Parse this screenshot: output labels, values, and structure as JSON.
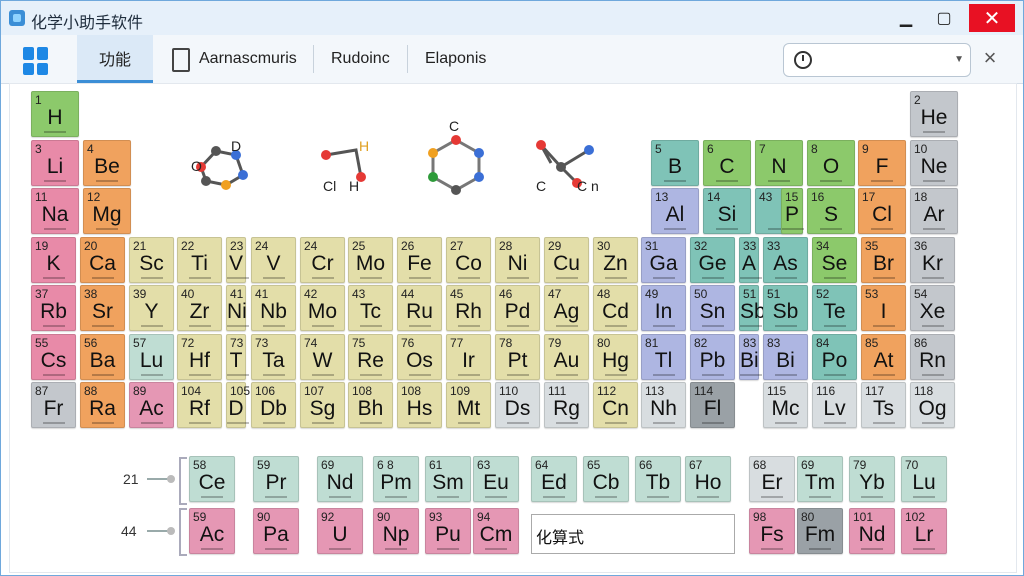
{
  "window": {
    "title": "化学小助手软件",
    "minimize_label": "▁",
    "maximize_label": "▢",
    "close_label": "✕"
  },
  "toolbar": {
    "tabs": [
      "功能",
      "Aarnascmuris",
      "Rudoinc",
      "Elaponis"
    ],
    "search": {
      "value": "",
      "placeholder": ""
    },
    "close_label": "×"
  },
  "colors": {
    "nonmetal": "#8cc96b",
    "alkali": "#e88aa8",
    "alkaline": "#f0a25e",
    "transition": "#e3dea9",
    "post": "#aeb6e2",
    "metalloid": "#7fc3b7",
    "halogen": "#f0a25e",
    "noble": "#c3c7cc",
    "lanth": "#bfddd3",
    "act": "#e597b4",
    "unknown": "#d8dde0",
    "dark": "#9aa1a6"
  },
  "elements": [
    {
      "n": "1",
      "s": "H",
      "c": "nonmetal",
      "r": 0,
      "col": 0
    },
    {
      "n": "2",
      "s": "He",
      "c": "noble",
      "r": 0,
      "col": 17
    },
    {
      "n": "3",
      "s": "Li",
      "c": "alkali",
      "r": 1,
      "col": 0
    },
    {
      "n": "4",
      "s": "Be",
      "c": "alkaline",
      "r": 1,
      "col": 1
    },
    {
      "n": "5",
      "s": "B",
      "c": "metalloid",
      "r": 1,
      "col": 12
    },
    {
      "n": "6",
      "s": "C",
      "c": "nonmetal",
      "r": 1,
      "col": 13
    },
    {
      "n": "7",
      "s": "N",
      "c": "nonmetal",
      "r": 1,
      "col": 14
    },
    {
      "n": "8",
      "s": "O",
      "c": "nonmetal",
      "r": 1,
      "col": 15
    },
    {
      "n": "9",
      "s": "F",
      "c": "halogen",
      "r": 1,
      "col": 16
    },
    {
      "n": "10",
      "s": "Ne",
      "c": "noble",
      "r": 1,
      "col": 17
    },
    {
      "n": "11",
      "s": "Na",
      "c": "alkali",
      "r": 2,
      "col": 0
    },
    {
      "n": "12",
      "s": "Mg",
      "c": "alkaline",
      "r": 2,
      "col": 1
    },
    {
      "n": "13",
      "s": "Al",
      "c": "post",
      "r": 2,
      "col": 12
    },
    {
      "n": "14",
      "s": "Si",
      "c": "metalloid",
      "r": 2,
      "col": 13
    },
    {
      "n": "43",
      "s": "",
      "c": "metalloid",
      "r": 2,
      "col": 14,
      "half": true
    },
    {
      "n": "15",
      "s": "P",
      "c": "nonmetal",
      "r": 2,
      "col": 14.5,
      "w": 0.5
    },
    {
      "n": "16",
      "s": "S",
      "c": "nonmetal",
      "r": 2,
      "col": 15
    },
    {
      "n": "17",
      "s": "Cl",
      "c": "halogen",
      "r": 2,
      "col": 16
    },
    {
      "n": "18",
      "s": "Ar",
      "c": "noble",
      "r": 2,
      "col": 17
    },
    {
      "n": "19",
      "s": "K",
      "c": "alkali",
      "r": 3,
      "col": 0
    },
    {
      "n": "20",
      "s": "Ca",
      "c": "alkaline",
      "r": 3,
      "col": 1
    },
    {
      "n": "21",
      "s": "Sc",
      "c": "transition",
      "r": 3,
      "col": 2
    },
    {
      "n": "22",
      "s": "Ti",
      "c": "transition",
      "r": 3,
      "col": 3
    },
    {
      "n": "23",
      "s": "V",
      "c": "transition",
      "r": 3,
      "col": 4,
      "w": 0.5
    },
    {
      "n": "24",
      "s": "V",
      "c": "transition",
      "r": 3,
      "col": 4.5
    },
    {
      "n": "24",
      "s": "Cr",
      "c": "transition",
      "r": 3,
      "col": 5.5
    },
    {
      "n": "25",
      "s": "Mo",
      "c": "transition",
      "r": 3,
      "col": 6.5
    },
    {
      "n": "26",
      "s": "Fe",
      "c": "transition",
      "r": 3,
      "col": 7.5
    },
    {
      "n": "27",
      "s": "Co",
      "c": "transition",
      "r": 3,
      "col": 8.5
    },
    {
      "n": "28",
      "s": "Ni",
      "c": "transition",
      "r": 3,
      "col": 9.5
    },
    {
      "n": "29",
      "s": "Cu",
      "c": "transition",
      "r": 3,
      "col": 10.5
    },
    {
      "n": "30",
      "s": "Zn",
      "c": "transition",
      "r": 3,
      "col": 11.5
    },
    {
      "n": "31",
      "s": "Ga",
      "c": "post",
      "r": 3,
      "col": 12.5
    },
    {
      "n": "32",
      "s": "Ge",
      "c": "metalloid",
      "r": 3,
      "col": 13.5
    },
    {
      "n": "33",
      "s": "A",
      "c": "metalloid",
      "r": 3,
      "col": 14.5,
      "w": 0.5
    },
    {
      "n": "33",
      "s": "As",
      "c": "metalloid",
      "r": 3,
      "col": 15
    },
    {
      "n": "34",
      "s": "Se",
      "c": "nonmetal",
      "r": 3,
      "col": 16
    },
    {
      "n": "35",
      "s": "Br",
      "c": "halogen",
      "r": 3,
      "col": 17
    },
    {
      "n": "36",
      "s": "Kr",
      "c": "noble",
      "r": 3,
      "col": 18
    },
    {
      "n": "37",
      "s": "Rb",
      "c": "alkali",
      "r": 4,
      "col": 0
    },
    {
      "n": "38",
      "s": "Sr",
      "c": "alkaline",
      "r": 4,
      "col": 1
    },
    {
      "n": "39",
      "s": "Y",
      "c": "transition",
      "r": 4,
      "col": 2
    },
    {
      "n": "40",
      "s": "Zr",
      "c": "transition",
      "r": 4,
      "col": 3
    },
    {
      "n": "41",
      "s": "Ni",
      "c": "transition",
      "r": 4,
      "col": 4,
      "w": 0.5
    },
    {
      "n": "41",
      "s": "Nb",
      "c": "transition",
      "r": 4,
      "col": 4.5
    },
    {
      "n": "42",
      "s": "Mo",
      "c": "transition",
      "r": 4,
      "col": 5.5
    },
    {
      "n": "43",
      "s": "Tc",
      "c": "transition",
      "r": 4,
      "col": 6.5
    },
    {
      "n": "44",
      "s": "Ru",
      "c": "transition",
      "r": 4,
      "col": 7.5
    },
    {
      "n": "45",
      "s": "Rh",
      "c": "transition",
      "r": 4,
      "col": 8.5
    },
    {
      "n": "46",
      "s": "Pd",
      "c": "transition",
      "r": 4,
      "col": 9.5
    },
    {
      "n": "47",
      "s": "Ag",
      "c": "transition",
      "r": 4,
      "col": 10.5
    },
    {
      "n": "48",
      "s": "Cd",
      "c": "transition",
      "r": 4,
      "col": 11.5
    },
    {
      "n": "49",
      "s": "In",
      "c": "post",
      "r": 4,
      "col": 12.5
    },
    {
      "n": "50",
      "s": "Sn",
      "c": "post",
      "r": 4,
      "col": 13.5
    },
    {
      "n": "51",
      "s": "Sb",
      "c": "metalloid",
      "r": 4,
      "col": 14.5,
      "w": 0.5
    },
    {
      "n": "51",
      "s": "Sb",
      "c": "metalloid",
      "r": 4,
      "col": 15
    },
    {
      "n": "52",
      "s": "Te",
      "c": "metalloid",
      "r": 4,
      "col": 16
    },
    {
      "n": "53",
      "s": "I",
      "c": "halogen",
      "r": 4,
      "col": 17
    },
    {
      "n": "54",
      "s": "Xe",
      "c": "noble",
      "r": 4,
      "col": 18
    },
    {
      "n": "55",
      "s": "Cs",
      "c": "alkali",
      "r": 5,
      "col": 0
    },
    {
      "n": "56",
      "s": "Ba",
      "c": "alkaline",
      "r": 5,
      "col": 1
    },
    {
      "n": "57",
      "s": "Lu",
      "c": "lanth",
      "r": 5,
      "col": 2
    },
    {
      "n": "72",
      "s": "Hf",
      "c": "transition",
      "r": 5,
      "col": 3
    },
    {
      "n": "73",
      "s": "T",
      "c": "transition",
      "r": 5,
      "col": 4,
      "w": 0.5
    },
    {
      "n": "73",
      "s": "Ta",
      "c": "transition",
      "r": 5,
      "col": 4.5
    },
    {
      "n": "74",
      "s": "W",
      "c": "transition",
      "r": 5,
      "col": 5.5
    },
    {
      "n": "75",
      "s": "Re",
      "c": "transition",
      "r": 5,
      "col": 6.5
    },
    {
      "n": "76",
      "s": "Os",
      "c": "transition",
      "r": 5,
      "col": 7.5
    },
    {
      "n": "77",
      "s": "Ir",
      "c": "transition",
      "r": 5,
      "col": 8.5
    },
    {
      "n": "78",
      "s": "Pt",
      "c": "transition",
      "r": 5,
      "col": 9.5
    },
    {
      "n": "79",
      "s": "Au",
      "c": "transition",
      "r": 5,
      "col": 10.5
    },
    {
      "n": "80",
      "s": "Hg",
      "c": "transition",
      "r": 5,
      "col": 11.5
    },
    {
      "n": "81",
      "s": "Tl",
      "c": "post",
      "r": 5,
      "col": 12.5
    },
    {
      "n": "82",
      "s": "Pb",
      "c": "post",
      "r": 5,
      "col": 13.5
    },
    {
      "n": "83",
      "s": "Bi",
      "c": "post",
      "r": 5,
      "col": 14.5,
      "w": 0.5
    },
    {
      "n": "83",
      "s": "Bi",
      "c": "post",
      "r": 5,
      "col": 15
    },
    {
      "n": "84",
      "s": "Po",
      "c": "metalloid",
      "r": 5,
      "col": 16
    },
    {
      "n": "85",
      "s": "At",
      "c": "halogen",
      "r": 5,
      "col": 17
    },
    {
      "n": "86",
      "s": "Rn",
      "c": "noble",
      "r": 5,
      "col": 18
    },
    {
      "n": "87",
      "s": "Fr",
      "c": "noble",
      "r": 6,
      "col": 0
    },
    {
      "n": "88",
      "s": "Ra",
      "c": "alkaline",
      "r": 6,
      "col": 1
    },
    {
      "n": "89",
      "s": "Ac",
      "c": "act",
      "r": 6,
      "col": 2
    },
    {
      "n": "104",
      "s": "Rf",
      "c": "transition",
      "r": 6,
      "col": 3
    },
    {
      "n": "105",
      "s": "D",
      "c": "transition",
      "r": 6,
      "col": 4,
      "w": 0.5
    },
    {
      "n": "106",
      "s": "Db",
      "c": "transition",
      "r": 6,
      "col": 4.5
    },
    {
      "n": "107",
      "s": "Sg",
      "c": "transition",
      "r": 6,
      "col": 5.5
    },
    {
      "n": "108",
      "s": "Bh",
      "c": "transition",
      "r": 6,
      "col": 6.5
    },
    {
      "n": "108",
      "s": "Hs",
      "c": "transition",
      "r": 6,
      "col": 7.5
    },
    {
      "n": "109",
      "s": "Mt",
      "c": "transition",
      "r": 6,
      "col": 8.5
    },
    {
      "n": "110",
      "s": "Ds",
      "c": "unknown",
      "r": 6,
      "col": 9.5
    },
    {
      "n": "111",
      "s": "Rg",
      "c": "unknown",
      "r": 6,
      "col": 10.5
    },
    {
      "n": "112",
      "s": "Cn",
      "c": "transition",
      "r": 6,
      "col": 11.5
    },
    {
      "n": "113",
      "s": "Nh",
      "c": "unknown",
      "r": 6,
      "col": 12.5
    },
    {
      "n": "114",
      "s": "Fl",
      "c": "dark",
      "r": 6,
      "col": 13.5
    },
    {
      "n": "115",
      "s": "Mc",
      "c": "unknown",
      "r": 6,
      "col": 15
    },
    {
      "n": "116",
      "s": "Lv",
      "c": "unknown",
      "r": 6,
      "col": 16
    },
    {
      "n": "117",
      "s": "Ts",
      "c": "unknown",
      "r": 6,
      "col": 17
    },
    {
      "n": "118",
      "s": "Og",
      "c": "unknown",
      "r": 6,
      "col": 18
    }
  ],
  "lanthanides": {
    "label": "21",
    "items": [
      {
        "n": "58",
        "s": "Ce",
        "c": "lanth"
      },
      {
        "n": "59",
        "s": "Pr",
        "c": "lanth"
      },
      {
        "n": "69",
        "s": "Nd",
        "c": "lanth"
      },
      {
        "n": "6 8",
        "s": "Pm",
        "c": "lanth"
      },
      {
        "n": "61",
        "s": "Sm",
        "c": "lanth"
      },
      {
        "n": "63",
        "s": "Eu",
        "c": "lanth"
      },
      {
        "n": "64",
        "s": "Ed",
        "c": "lanth"
      },
      {
        "n": "65",
        "s": "Cb",
        "c": "lanth"
      },
      {
        "n": "66",
        "s": "Tb",
        "c": "lanth"
      },
      {
        "n": "67",
        "s": "Ho",
        "c": "lanth"
      },
      {
        "n": "68",
        "s": "Er",
        "c": "unknown"
      },
      {
        "n": "69",
        "s": "Tm",
        "c": "lanth"
      },
      {
        "n": "79",
        "s": "Yb",
        "c": "lanth"
      },
      {
        "n": "70",
        "s": "Lu",
        "c": "lanth"
      }
    ]
  },
  "actinides": {
    "label": "44",
    "items": [
      {
        "n": "59",
        "s": "Ac",
        "c": "act"
      },
      {
        "n": "90",
        "s": "Pa",
        "c": "act"
      },
      {
        "n": "92",
        "s": "U",
        "c": "act"
      },
      {
        "n": "90",
        "s": "Np",
        "c": "act"
      },
      {
        "n": "93",
        "s": "Pu",
        "c": "act"
      },
      {
        "n": "94",
        "s": "Cm",
        "c": "act"
      },
      {
        "n": "98",
        "s": "Fs",
        "c": "act"
      },
      {
        "n": "80",
        "s": "Fm",
        "c": "dark"
      },
      {
        "n": "101",
        "s": "Nd",
        "c": "act"
      },
      {
        "n": "102",
        "s": "Lr",
        "c": "act"
      }
    ]
  },
  "formula": {
    "label": "化算式"
  },
  "molecules": {
    "m1": [
      "O",
      "D"
    ],
    "m2": [
      "H",
      "Cl",
      "H"
    ],
    "m3": [
      "C",
      "O"
    ],
    "m4": [
      "C",
      "C",
      "n"
    ]
  }
}
